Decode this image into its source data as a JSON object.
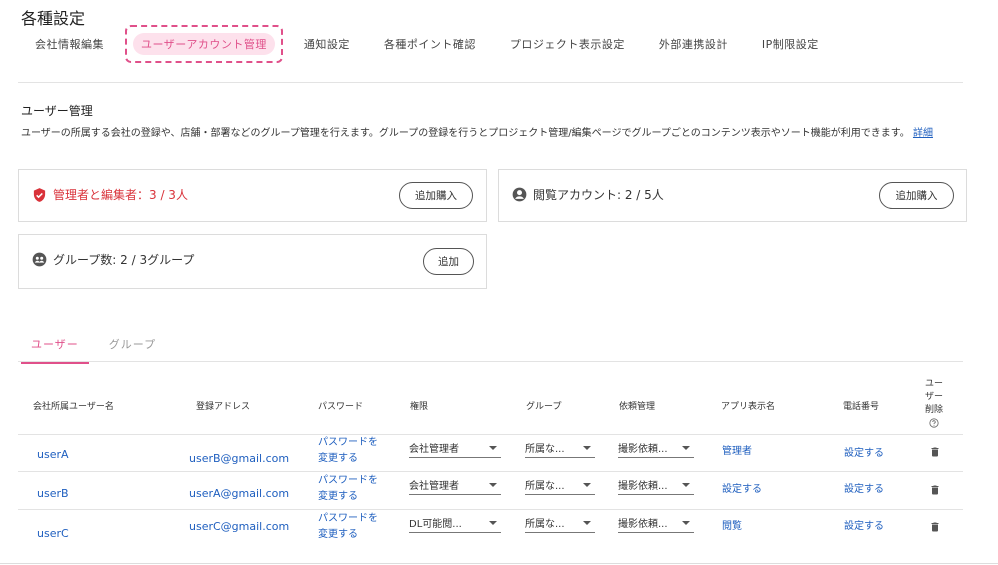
{
  "page_title": "各種設定",
  "nav": [
    "会社情報編集",
    "ユーザーアカウント管理",
    "通知設定",
    "各種ポイント確認",
    "プロジェクト表示設定",
    "外部連携設計",
    "IP制限設定"
  ],
  "section": {
    "title": "ユーザー管理",
    "desc": "ユーザーの所属する会社の登録や、店舗・部署などのグループ管理を行えます。グループの登録を行うとプロジェクト管理/編集ページでグループごとのコンテンツ表示やソート機能が利用できます。",
    "detail_link": "詳細"
  },
  "cards": {
    "admins": {
      "label": "管理者と編集者：3 / 3人",
      "button": "追加購入",
      "color": "#d9323a"
    },
    "viewers": {
      "label": "閲覧アカウント: 2 / 5人",
      "button": "追加購入"
    },
    "groups": {
      "label": "グループ数: 2 / 3グループ",
      "button": "追加"
    }
  },
  "tabs": [
    "ユーザー",
    "グループ"
  ],
  "table": {
    "headers": [
      "会社所属ユーザー名",
      "登録アドレス",
      "パスワード",
      "権限",
      "グループ",
      "依頼管理",
      "アプリ表示名",
      "電話番号",
      "ユー",
      "ザー",
      "削除"
    ],
    "rows": [
      {
        "name": "userA",
        "email": "userB@gmail.com",
        "pw1": "パスワードを",
        "pw2": "変更する",
        "role": "会社管理者",
        "group": "所属な...",
        "request": "撮影依頼...",
        "app": "管理者",
        "phone": "設定する"
      },
      {
        "name": "userB",
        "email": "userA@gmail.com",
        "pw1": "パスワードを",
        "pw2": "変更する",
        "role": "会社管理者",
        "group": "所属な...",
        "request": "撮影依頼...",
        "app": "設定する",
        "phone": "設定する"
      },
      {
        "name": "userC",
        "email": "userC@gmail.com",
        "pw1": "パスワードを",
        "pw2": "変更する",
        "role": "DL可能閲...",
        "group": "所属な...",
        "request": "撮影依頼...",
        "app": "閲覧",
        "phone": "設定する"
      }
    ]
  },
  "colors": {
    "accent": "#e0508a",
    "link": "#1f5fbf",
    "danger": "#d9323a"
  }
}
